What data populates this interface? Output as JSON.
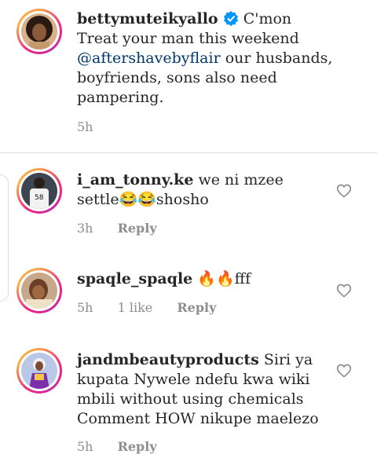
{
  "caption": {
    "username": "bettymuteikyallo",
    "text_before_mention": "C'mon Treat your man this weekend",
    "mention": "@aftershavebyflair",
    "text_after_mention": "our husbands, boyfriends, sons also need pampering.",
    "time": "5h"
  },
  "comments": [
    {
      "username": "i_am_tonny.ke",
      "text": "we ni mzee settle😂😂shosho",
      "time": "3h",
      "reply_label": "Reply"
    },
    {
      "username": "spaqle_spaqle",
      "text": "🔥🔥fff",
      "time": "5h",
      "likes": "1 like",
      "reply_label": "Reply"
    },
    {
      "username": "jandmbeautyproducts",
      "text": "Siri ya kupata Nywele ndefu kwa wiki mbili without using chemicals Comment HOW nikupe maelezo",
      "time": "5h",
      "reply_label": "Reply"
    }
  ],
  "icons": {
    "verified": "verified-badge-icon",
    "like": "heart-icon"
  },
  "colors": {
    "verified_blue": "#0095f6",
    "mention_blue": "#00376b",
    "meta_gray": "#8e8e8e"
  }
}
